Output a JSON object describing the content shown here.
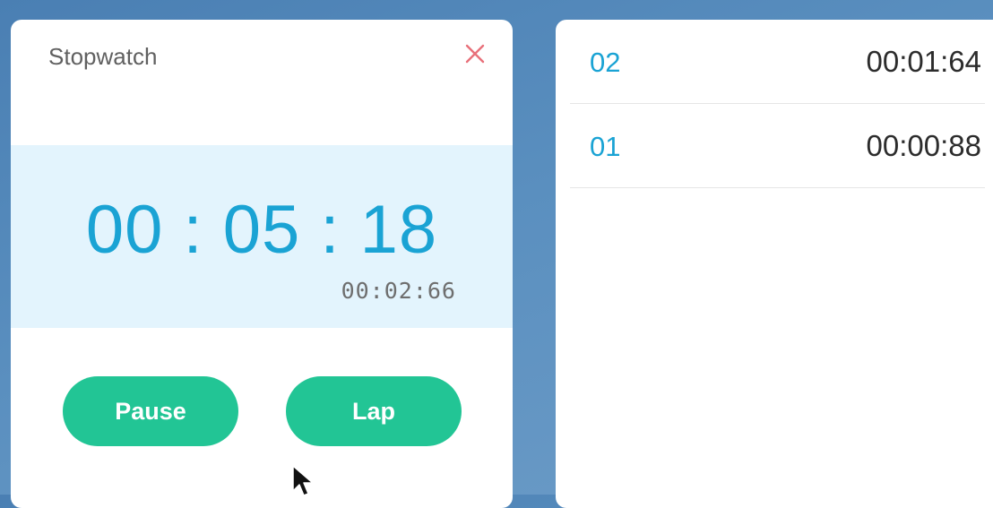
{
  "stopwatch": {
    "title": "Stopwatch",
    "close_icon": "close-icon",
    "main_time": "00 : 05 : 18",
    "current_lap_time": "00:02:66",
    "pause_label": "Pause",
    "lap_label": "Lap"
  },
  "laps": [
    {
      "number": "02",
      "time": "00:01:64"
    },
    {
      "number": "01",
      "time": "00:00:88"
    }
  ],
  "colors": {
    "accent": "#1aa3d4",
    "button": "#22c595",
    "close": "#e8707a",
    "display_bg": "#e3f4fd"
  }
}
